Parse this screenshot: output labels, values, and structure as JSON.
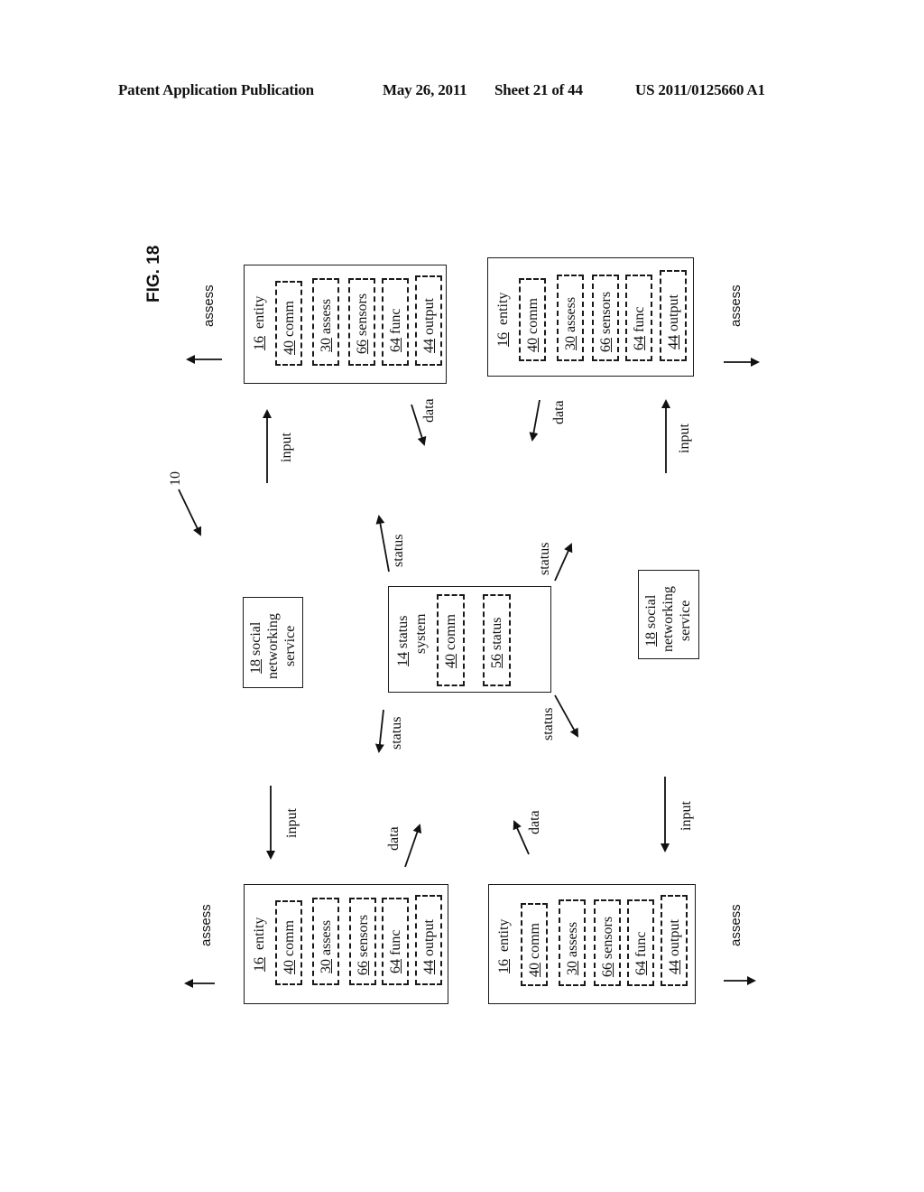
{
  "header": {
    "publication": "Patent Application Publication",
    "date": "May 26, 2011",
    "sheet": "Sheet 21 of 44",
    "number": "US 2011/0125660 A1"
  },
  "figure": {
    "label": "FIG. 18",
    "reference": "10"
  },
  "entity_box": {
    "title_num": "16",
    "title_text": "entity",
    "modules": [
      {
        "num": "40",
        "text": "comm"
      },
      {
        "num": "30",
        "text": "assess"
      },
      {
        "num": "66",
        "text": "sensors"
      },
      {
        "num": "64",
        "text": "func"
      },
      {
        "num": "44",
        "text": "output"
      }
    ]
  },
  "status_system": {
    "title_num": "14",
    "title_line1": "status",
    "title_line2": "system",
    "modules": [
      {
        "num": "40",
        "text": "comm"
      },
      {
        "num": "56",
        "text": "status"
      }
    ]
  },
  "social_service": {
    "num": "18",
    "line1": "social",
    "line2": "networking",
    "line3": "service"
  },
  "flow_labels": {
    "assess": "assess",
    "input": "input",
    "data": "data",
    "status": "status"
  }
}
